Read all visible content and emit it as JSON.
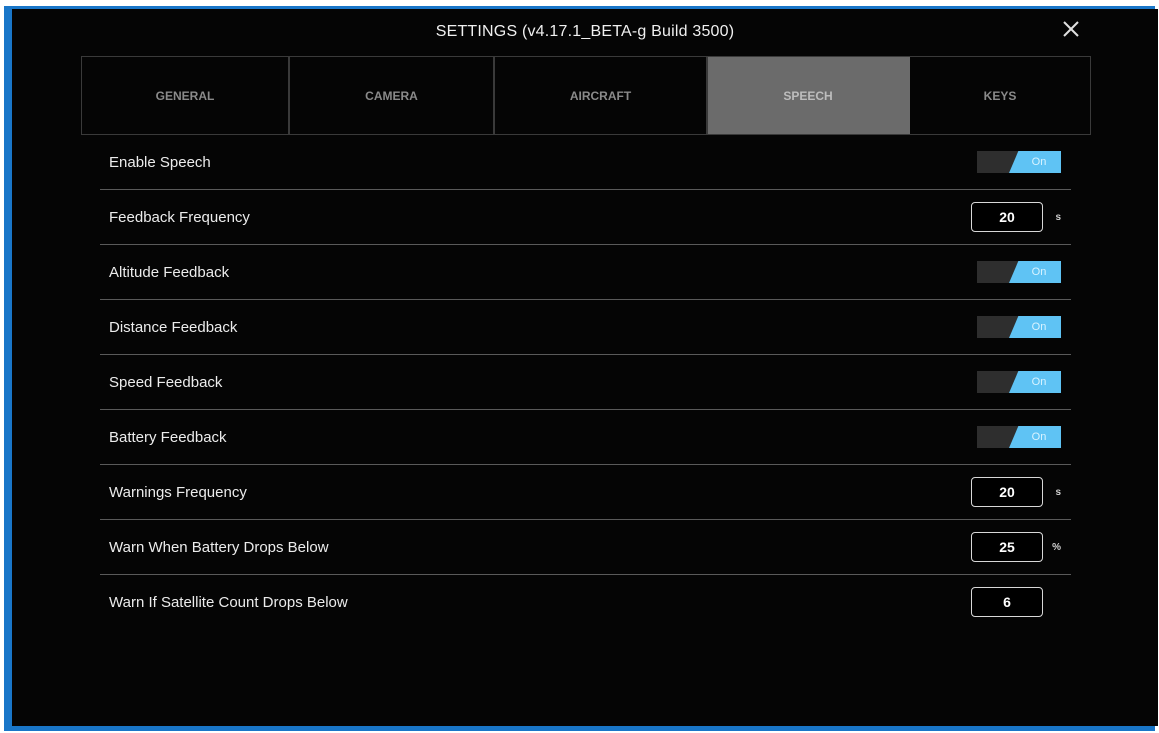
{
  "window": {
    "title": "SETTINGS (v4.17.1_BETA-g Build 3500)"
  },
  "tabs": [
    {
      "label": "GENERAL",
      "active": false
    },
    {
      "label": "CAMERA",
      "active": false
    },
    {
      "label": "AIRCRAFT",
      "active": false
    },
    {
      "label": "SPEECH",
      "active": true
    },
    {
      "label": "KEYS",
      "active": false
    }
  ],
  "settings": {
    "enable_speech": {
      "label": "Enable Speech",
      "state": "On"
    },
    "feedback_frequency": {
      "label": "Feedback Frequency",
      "value": "20",
      "unit": "s"
    },
    "altitude_feedback": {
      "label": "Altitude Feedback",
      "state": "On"
    },
    "distance_feedback": {
      "label": "Distance Feedback",
      "state": "On"
    },
    "speed_feedback": {
      "label": "Speed Feedback",
      "state": "On"
    },
    "battery_feedback": {
      "label": "Battery Feedback",
      "state": "On"
    },
    "warnings_frequency": {
      "label": "Warnings Frequency",
      "value": "20",
      "unit": "s"
    },
    "battery_warning": {
      "label": "Warn When Battery Drops Below",
      "value": "25",
      "unit": "%"
    },
    "satellite_warning": {
      "label": "Warn If Satellite Count Drops Below",
      "value": "6"
    }
  },
  "colors": {
    "frame_border": "#1976c8",
    "background": "#050505",
    "toggle_on": "#5fc3f4",
    "active_tab": "#6b6b6b"
  },
  "icons": {
    "close": "close-icon"
  }
}
